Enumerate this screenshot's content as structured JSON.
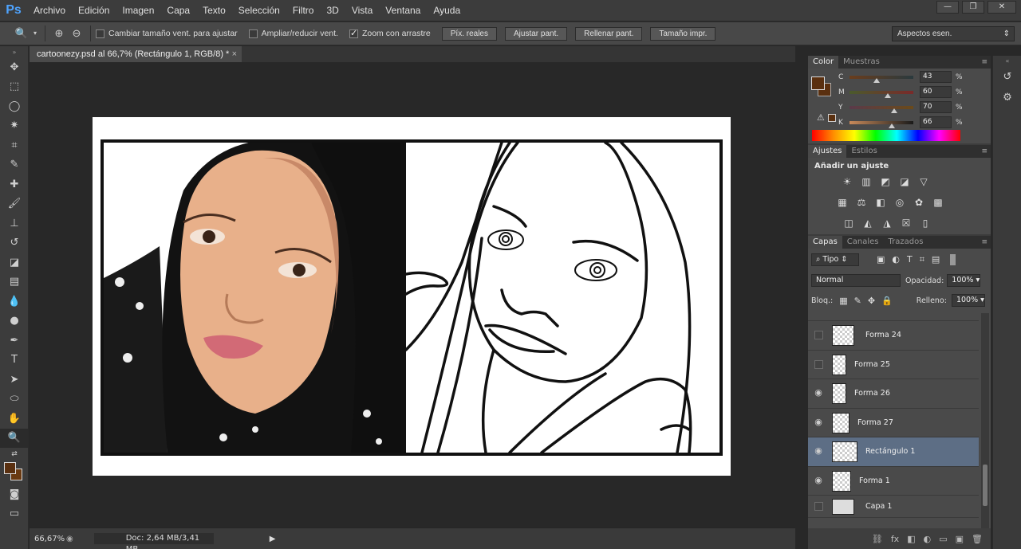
{
  "app": {
    "logo": "Ps",
    "menu": [
      "Archivo",
      "Edición",
      "Imagen",
      "Capa",
      "Texto",
      "Selección",
      "Filtro",
      "3D",
      "Vista",
      "Ventana",
      "Ayuda"
    ],
    "window_controls": {
      "minimize": "—",
      "restore": "❐",
      "close": "✕"
    }
  },
  "options_bar": {
    "checkboxes": [
      {
        "label": "Cambiar tamaño vent. para ajustar",
        "checked": false
      },
      {
        "label": "Ampliar/reducir vent.",
        "checked": false
      },
      {
        "label": "Zoom con arrastre",
        "checked": true
      }
    ],
    "buttons": [
      "Píx. reales",
      "Ajustar pant.",
      "Rellenar pant.",
      "Tamaño impr."
    ],
    "workspace": "Aspectos esen."
  },
  "document": {
    "tab_title": "cartoonezy.psd al 66,7% (Rectángulo 1, RGB/8) *",
    "close": "×"
  },
  "status": {
    "zoom": "66,67%",
    "doc_size": "Doc: 2,64 MB/3,41 MB"
  },
  "color_panel": {
    "tabs": [
      "Color",
      "Muestras"
    ],
    "foreground": "#5a3010",
    "background": "#ffffff",
    "channels": [
      {
        "label": "C",
        "value": "43",
        "unit": "%",
        "fraction": 0.43,
        "track": "linear-gradient(to right,#6a3d1c,#2a3a3e)"
      },
      {
        "label": "M",
        "value": "60",
        "unit": "%",
        "fraction": 0.6,
        "track": "linear-gradient(to right,#4a5a2c,#7a2a2a)"
      },
      {
        "label": "Y",
        "value": "70",
        "unit": "%",
        "fraction": 0.7,
        "track": "linear-gradient(to right,#5a3a4a,#6a4a1a)"
      },
      {
        "label": "K",
        "value": "66",
        "unit": "%",
        "fraction": 0.66,
        "track": "linear-gradient(to right,#c88a5a,#1a1a1a)"
      }
    ]
  },
  "adjustments_panel": {
    "tabs": [
      "Ajustes",
      "Estilos"
    ],
    "title": "Añadir un ajuste"
  },
  "layers_panel": {
    "tabs": [
      "Capas",
      "Canales",
      "Trazados"
    ],
    "filter": "Tipo",
    "blend_mode": "Normal",
    "opacity_label": "Opacidad:",
    "opacity": "100%",
    "lock_label": "Bloq.:",
    "fill_label": "Relleno:",
    "fill": "100%",
    "layers": [
      {
        "name": "Forma 24",
        "visible": false,
        "selected": false
      },
      {
        "name": "Forma 25",
        "visible": false,
        "selected": false
      },
      {
        "name": "Forma 26",
        "visible": true,
        "selected": false
      },
      {
        "name": "Forma 27",
        "visible": true,
        "selected": false
      },
      {
        "name": "Rectángulo 1",
        "visible": true,
        "selected": true
      },
      {
        "name": "Forma 1",
        "visible": true,
        "selected": false
      },
      {
        "name": "Capa 1",
        "visible": false,
        "selected": false
      }
    ],
    "footer_icons": [
      "⛓",
      "fx",
      "◧",
      "◐",
      "▭",
      "▣",
      "🗑"
    ]
  }
}
